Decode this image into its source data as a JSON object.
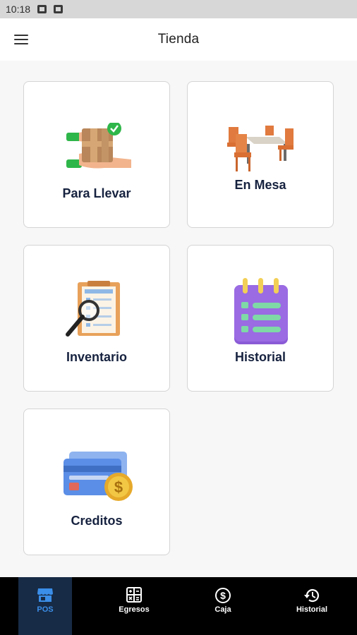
{
  "status_bar": {
    "time": "10:18"
  },
  "app_bar": {
    "title": "Tienda",
    "menu_icon": "hamburger-menu-icon"
  },
  "tiles": [
    {
      "label": "Para Llevar",
      "icon": "takeaway-box-icon"
    },
    {
      "label": "En Mesa",
      "icon": "dining-table-icon"
    },
    {
      "label": "Inventario",
      "icon": "inventory-clipboard-icon"
    },
    {
      "label": "Historial",
      "icon": "notepad-list-icon"
    },
    {
      "label": "Creditos",
      "icon": "credit-cards-icon"
    }
  ],
  "bottom_nav": [
    {
      "label": "POS",
      "icon": "store-icon",
      "active": true
    },
    {
      "label": "Egresos",
      "icon": "calculator-icon",
      "active": false
    },
    {
      "label": "Caja",
      "icon": "dollar-circle-icon",
      "active": false
    },
    {
      "label": "Historial",
      "icon": "history-clock-icon",
      "active": false
    }
  ],
  "colors": {
    "accent": "#3b8ee8",
    "nav_active_bg": "#172b46",
    "label_text": "#16223f"
  }
}
